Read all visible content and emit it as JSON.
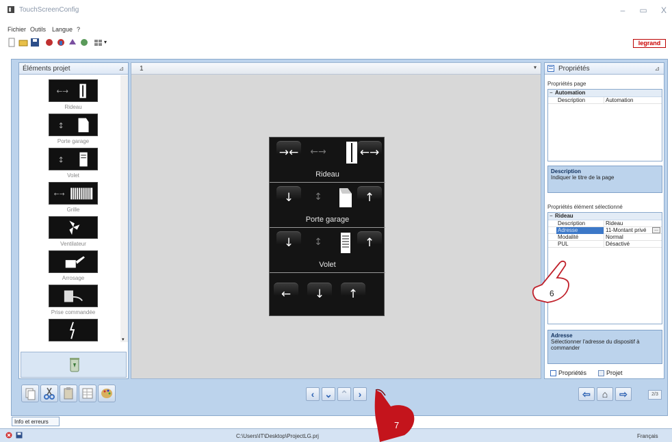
{
  "window": {
    "title": "TouchScreenConfig",
    "min": "–",
    "max": "▭",
    "close": "X"
  },
  "menu": [
    "Fichier",
    "Outils",
    "Langue",
    "?"
  ],
  "brand": {
    "logo_text": "legrand",
    "accent": "#c00000"
  },
  "left_panel": {
    "title": "Éléments projet",
    "items": [
      "Rideau",
      "Porte garage",
      "Volet",
      "Grille",
      "Ventilateur",
      "Arrosage",
      "Prise commandée"
    ]
  },
  "page_tab": {
    "number": "1"
  },
  "device": {
    "sections": [
      {
        "label": "Rideau",
        "buttons": [
          "→←",
          "←→",
          "←→"
        ]
      },
      {
        "label": "Porte garage",
        "buttons": [
          "↓",
          "↕",
          "↑"
        ]
      },
      {
        "label": "Volet",
        "buttons": [
          "↓",
          "↕",
          "↑"
        ]
      },
      {
        "label": "",
        "buttons": [
          "←",
          "↓",
          "↑"
        ]
      }
    ]
  },
  "properties": {
    "title": "Propriétés",
    "page_section": "Propriétés page",
    "page_group": "Automation",
    "page_rows": [
      {
        "key": "Description",
        "value": "Automation"
      }
    ],
    "desc1_title": "Description",
    "desc1_text": "Indiquer le titre de la page",
    "element_section": "Propriétés élément sélectionné",
    "element_group": "Rideau",
    "element_rows": [
      {
        "key": "Description",
        "value": "Rideau"
      },
      {
        "key": "Adresse",
        "value": "11-Montant privé"
      },
      {
        "key": "Modalité",
        "value": "Normal"
      },
      {
        "key": "PUL",
        "value": "Désactivé"
      }
    ],
    "desc2_title": "Adresse",
    "desc2_text": "Sélectionner l'adresse du dispositif à commander",
    "tab_props": "Propriétés",
    "tab_project": "Projet"
  },
  "nav": {
    "page_count": "2/3"
  },
  "info_tab": "Info et erreurs",
  "status": {
    "path": "C:\\Users\\IT\\Desktop\\ProjectLG.prj",
    "language": "Français"
  },
  "callouts": {
    "six": "6",
    "seven": "7"
  }
}
